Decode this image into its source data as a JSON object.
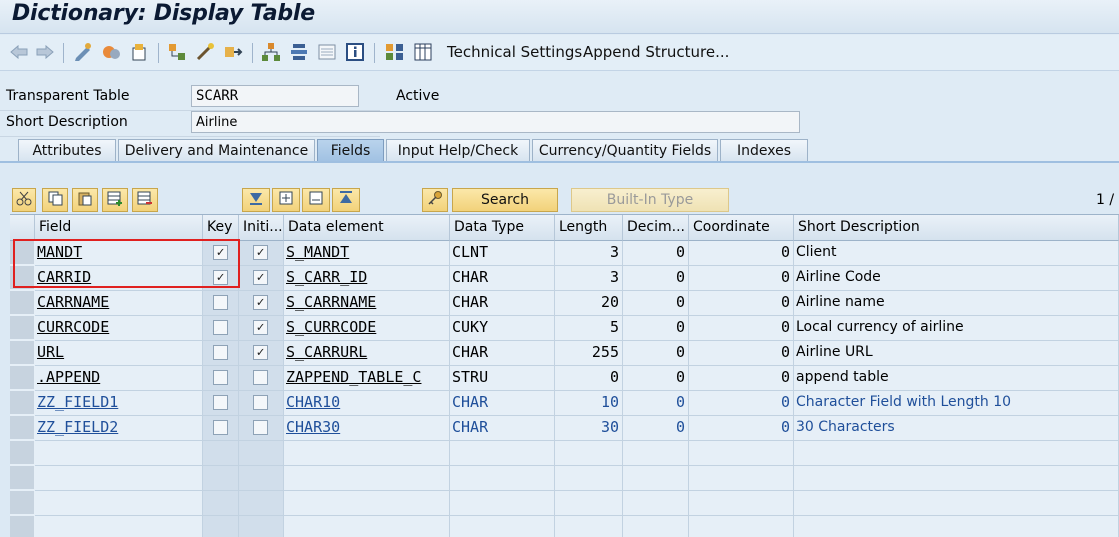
{
  "window": {
    "title": "Dictionary: Display Table"
  },
  "toolbar": {
    "icons": [
      "back-icon",
      "forward-icon",
      "display-change-icon",
      "active-inactive-icon",
      "other-object-icon",
      "where-used-icon",
      "navigate-icon",
      "transport-icon",
      "hierarchy-icon",
      "object-list-icon",
      "display-object-list-icon",
      "info-icon",
      "entity-icon",
      "contents-icon"
    ],
    "technical_settings": "Technical Settings",
    "append_structure": "Append Structure..."
  },
  "header": {
    "type_label": "Transparent Table",
    "table_name": "SCARR",
    "status": "Active",
    "short_desc_label": "Short Description",
    "short_desc_value": "Airline"
  },
  "tabs": [
    {
      "label": "Attributes"
    },
    {
      "label": "Delivery and Maintenance"
    },
    {
      "label": "Fields",
      "active": true
    },
    {
      "label": "Input Help/Check"
    },
    {
      "label": "Currency/Quantity Fields"
    },
    {
      "label": "Indexes"
    }
  ],
  "grid_toolbar": {
    "search_label": "Search",
    "builtin_label": "Built-In Type",
    "counter": "1 /"
  },
  "columns": {
    "field": "Field",
    "key": "Key",
    "initial": "Initi...",
    "data_element": "Data element",
    "data_type": "Data Type",
    "length": "Length",
    "decimals": "Decim...",
    "coordinate": "Coordinate",
    "short_description": "Short Description"
  },
  "rows": [
    {
      "field": "MANDT",
      "key": true,
      "initial": true,
      "data_element": "S_MANDT",
      "data_type": "CLNT",
      "length": "3",
      "decimals": "0",
      "coordinate": "0",
      "short_description": "Client"
    },
    {
      "field": "CARRID",
      "key": true,
      "initial": true,
      "data_element": "S_CARR_ID",
      "data_type": "CHAR",
      "length": "3",
      "decimals": "0",
      "coordinate": "0",
      "short_description": "Airline Code"
    },
    {
      "field": "CARRNAME",
      "key": false,
      "initial": true,
      "data_element": "S_CARRNAME",
      "data_type": "CHAR",
      "length": "20",
      "decimals": "0",
      "coordinate": "0",
      "short_description": "Airline name"
    },
    {
      "field": "CURRCODE",
      "key": false,
      "initial": true,
      "data_element": "S_CURRCODE",
      "data_type": "CUKY",
      "length": "5",
      "decimals": "0",
      "coordinate": "0",
      "short_description": "Local currency of airline"
    },
    {
      "field": "URL",
      "key": false,
      "initial": true,
      "data_element": "S_CARRURL",
      "data_type": "CHAR",
      "length": "255",
      "decimals": "0",
      "coordinate": "0",
      "short_description": "Airline URL"
    },
    {
      "field": ".APPEND",
      "key": false,
      "initial": false,
      "data_element": "ZAPPEND_TABLE_C",
      "data_type": "STRU",
      "length": "0",
      "decimals": "0",
      "coordinate": "0",
      "short_description": "append table"
    },
    {
      "field": "ZZ_FIELD1",
      "key": false,
      "initial": false,
      "data_element": "CHAR10",
      "data_type": "CHAR",
      "length": "10",
      "decimals": "0",
      "coordinate": "0",
      "short_description": "Character Field with Length 10",
      "highlight": true
    },
    {
      "field": "ZZ_FIELD2",
      "key": false,
      "initial": false,
      "data_element": "CHAR30",
      "data_type": "CHAR",
      "length": "30",
      "decimals": "0",
      "coordinate": "0",
      "short_description": "30 Characters",
      "highlight": true
    }
  ],
  "colors": {
    "highlight_text": "#1f4f9a",
    "annotation_box": "#e0201f",
    "active_tab": "#a9c8e6"
  }
}
